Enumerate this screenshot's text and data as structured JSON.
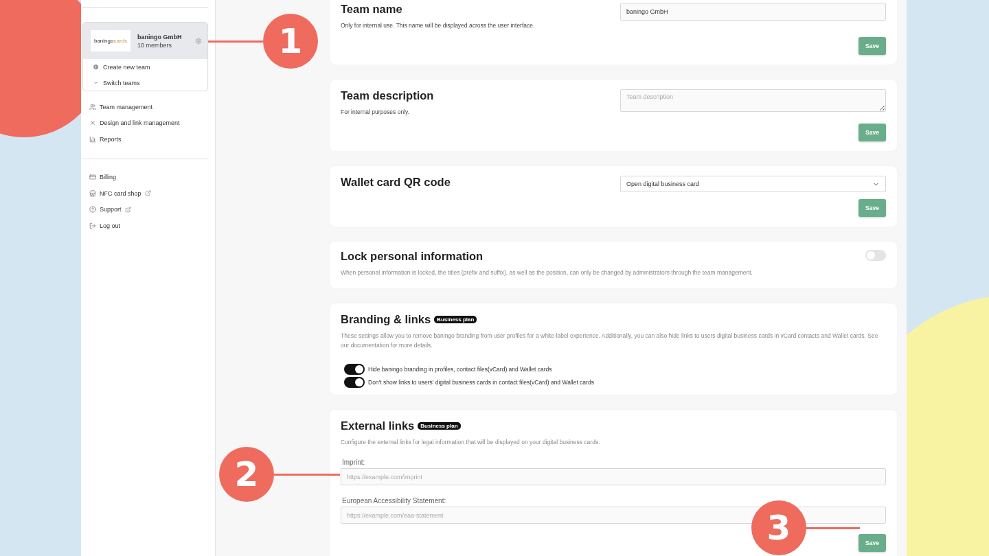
{
  "sidebar": {
    "team": {
      "logo": [
        "baningo",
        "cards"
      ],
      "name": "baningo GmbH",
      "members": "10 members",
      "actions": [
        "Create new team",
        "Switch teams"
      ]
    },
    "nav": [
      {
        "label": "Team management",
        "external": false
      },
      {
        "label": "Design and link management",
        "external": false
      },
      {
        "label": "Reports",
        "external": false
      }
    ],
    "footer_nav": [
      {
        "label": "Billing",
        "external": false
      },
      {
        "label": "NFC card shop",
        "external": true
      },
      {
        "label": "Support",
        "external": true
      },
      {
        "label": "Log out",
        "external": false
      }
    ]
  },
  "cards": [
    {
      "kind": "input",
      "title": "Team name",
      "description": "Only for internal use. This name will be displayed across the user interface.",
      "value": "baningo GmbH",
      "button": "Save"
    },
    {
      "kind": "textarea",
      "title": "Team description",
      "description": "For internal purposes only.",
      "placeholder": "Team description",
      "button": "Save"
    },
    {
      "kind": "select",
      "title": "Wallet card QR code",
      "value": "Open digital business card",
      "button": "Save"
    },
    {
      "kind": "switch",
      "title": "Lock personal information",
      "description": "When personal information is locked, the titles (prefix and suffix), as well as the position, can only be changed by administrators through the team management.",
      "on": false
    },
    {
      "kind": "options",
      "title": "Branding & links",
      "badge": "Business plan",
      "description": "These settings allow you to remove baningo branding from user profiles for a white-label experience. Additionally, you can also hide links to users digital business cards in vCard contacts and Wallet cards. See our documentation for more details.",
      "options": [
        {
          "label": "Hide baningo branding in profiles, contact files(vCard) and Wallet cards",
          "on": true
        },
        {
          "label": "Don't show links to users' digital business cards in contact files(vCard) and Wallet cards",
          "on": true
        }
      ]
    },
    {
      "kind": "fields",
      "title": "External links",
      "badge": "Business plan",
      "description": "Configure the external links for legal information that will be displayed on your digital business cards.",
      "fields": [
        {
          "label": "Imprint:",
          "placeholder": "https://example.com/imprint"
        },
        {
          "label": "European Accessibility Statement:",
          "placeholder": "https://example.com/eaa-statement"
        }
      ],
      "button": "Save"
    }
  ],
  "callouts": [
    "1",
    "2",
    "3"
  ]
}
